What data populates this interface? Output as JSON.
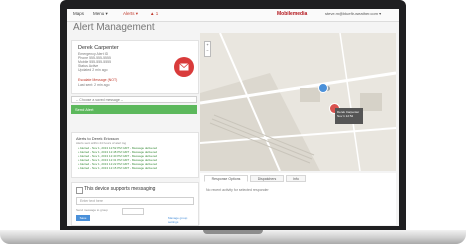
{
  "topbar": {
    "items": [
      {
        "label": "Maps",
        "active": false
      },
      {
        "label": "Menu ▾",
        "active": false
      },
      {
        "label": "Alerts ▾",
        "active": true
      },
      {
        "label": "▲ 1",
        "active": true
      }
    ],
    "brand": "Mobilemedia",
    "user_email": "steve.m@bluefir-weather.com ▾"
  },
  "page": {
    "title": "Alert Management"
  },
  "contact": {
    "name": "Derek Carpenter",
    "lines": [
      "Emergency Alert ID",
      "Phone 555-555-5555",
      "Mobile 555-555-5555",
      "Status Active",
      "Updated 2 min ago"
    ],
    "alert_label": "Escalate Message (NOT)",
    "alert_sub": "Last sent: 2 min ago",
    "envelope_icon": "envelope-icon"
  },
  "messaging": {
    "select_placeholder": "-- Choose a saved message --",
    "send_label": "Send Alert"
  },
  "alerts": {
    "title": "Alerts to Derek Ericsson",
    "subtitle": "Alerts sent within 24 hours of alert log",
    "rows": [
      "• Alerted - Nov 1, 2013 12:52 PM GMT - Message delivered",
      "• Alerted - Nov 1, 2013 12:48 PM GMT - Message delivered",
      "• Alerted - Nov 1, 2013 12:40 PM GMT - Message delivered",
      "• Alerted - Nov 1, 2013 12:31 PM GMT - Message delivered",
      "• Alerted - Nov 1, 2013 12:22 PM GMT - Message delivered",
      "• Alerted - Nov 1, 2013 12:15 PM GMT - Message delivered"
    ]
  },
  "engagement": {
    "label": "This device supports messaging",
    "input_placeholder": "Enter text here",
    "hint": "Send message to group",
    "save_label": "Save",
    "link": "Manage group settings"
  },
  "map": {
    "zoom_in": "+",
    "zoom_out": "−",
    "popup_title": "Derek Carpenter",
    "popup_sub": "Nov 1 12:52"
  },
  "tabs": {
    "items": [
      {
        "label": "Response Options",
        "active": true
      },
      {
        "label": "Dispatchers",
        "active": false
      },
      {
        "label": "Info",
        "active": false
      }
    ],
    "content": "No recent activity for selected responder"
  },
  "colors": {
    "accent_red": "#d93b3b",
    "send_green": "#5cb85c",
    "link_blue": "#4a90d9"
  }
}
